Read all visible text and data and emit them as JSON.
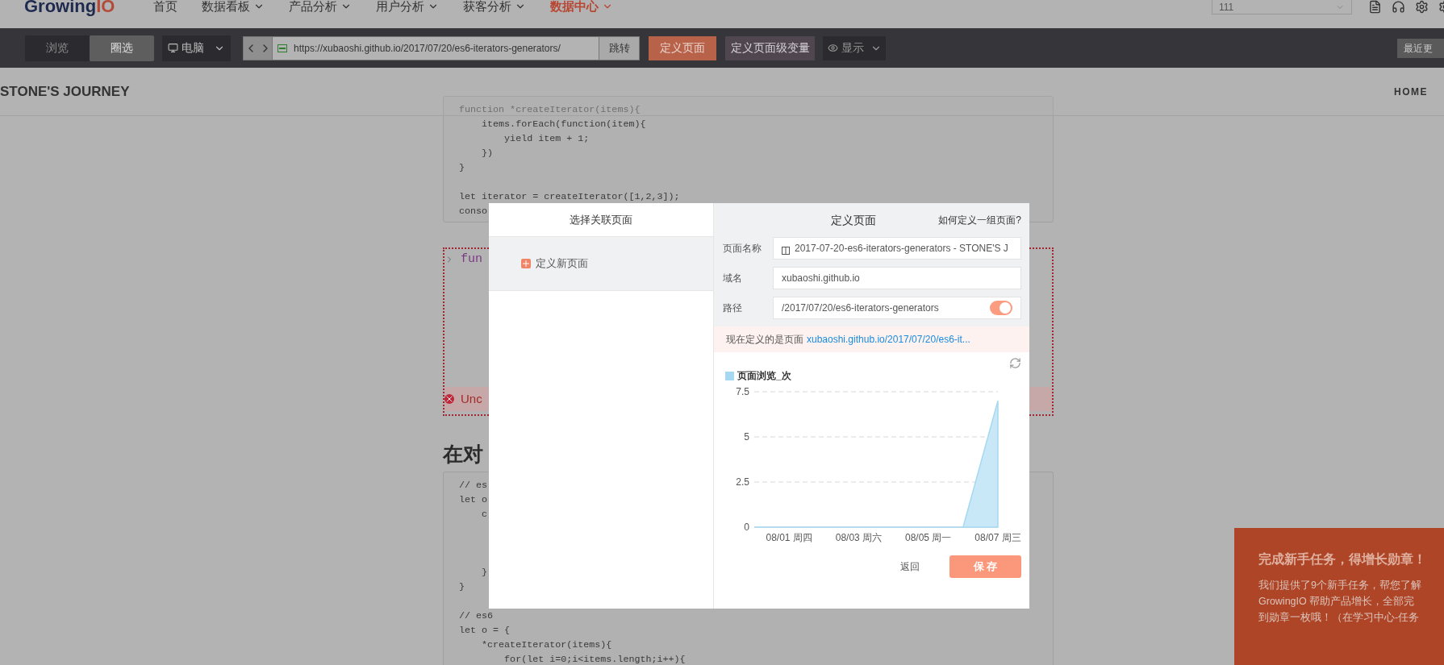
{
  "nav": {
    "logo": {
      "text": "Growing",
      "accent": "IO"
    },
    "items": [
      {
        "label": "首页",
        "dropdown": false,
        "selected": false
      },
      {
        "label": "数据看板",
        "dropdown": true,
        "selected": false
      },
      {
        "label": "产品分析",
        "dropdown": true,
        "selected": false
      },
      {
        "label": "用户分析",
        "dropdown": true,
        "selected": false
      },
      {
        "label": "获客分析",
        "dropdown": true,
        "selected": false
      },
      {
        "label": "数据中心",
        "dropdown": true,
        "selected": true
      }
    ],
    "project_select": {
      "value": "111"
    }
  },
  "toolbar": {
    "modes": [
      {
        "label": "浏览",
        "selected": false
      },
      {
        "label": "圈选",
        "selected": true
      }
    ],
    "device": {
      "label": "电脑"
    },
    "url": "https://xubaoshi.github.io/2017/07/20/es6-iterators-generators/",
    "go_button": "跳转",
    "define_page_button": "定义页面",
    "define_variable_button": "定义页面级变量",
    "display": {
      "label": "显示"
    },
    "recent_button": "最近更"
  },
  "site": {
    "title": "STONE'S JOURNEY",
    "nav_link": "HOME",
    "code_block_1": [
      {
        "kind": "faded",
        "text": "function *createIterator(items){"
      },
      {
        "kind": "code",
        "text": "    items.forEach(function(item){"
      },
      {
        "kind": "code",
        "text": "        yield item + 1;"
      },
      {
        "kind": "code",
        "text": "    })"
      },
      {
        "kind": "code",
        "text": "}"
      },
      {
        "kind": "blank"
      },
      {
        "kind": "code",
        "text": "let iterator = createIterator([1,2,3]);"
      },
      {
        "kind": "code",
        "text": "conso"
      }
    ],
    "console": {
      "input": "fun",
      "error": "Unc"
    },
    "heading": "在对",
    "code_block_2": [
      {
        "kind": "code",
        "text": "// es"
      },
      {
        "kind": "code",
        "text": "let o"
      },
      {
        "kind": "code",
        "text": "    c"
      },
      {
        "kind": "blank"
      },
      {
        "kind": "blank"
      },
      {
        "kind": "blank"
      },
      {
        "kind": "code",
        "text": "    }"
      },
      {
        "kind": "code",
        "text": "}"
      },
      {
        "kind": "blank"
      },
      {
        "kind": "code",
        "text": "// es6"
      },
      {
        "kind": "code",
        "text": "let o = {"
      },
      {
        "kind": "code",
        "text": "    *createIterator(items){"
      },
      {
        "kind": "code",
        "text": "        for(let i=0;i<items.length;i++){"
      }
    ]
  },
  "modal": {
    "left": {
      "title": "选择关联页面",
      "items": [
        {
          "label": "定义新页面",
          "selected": true
        }
      ]
    },
    "right": {
      "title": "定义页面",
      "help_link": "如何定义一组页面?",
      "fields": [
        {
          "label": "页面名称",
          "value": "2017-07-20-es6-iterators-generators - STONE'S J",
          "icon": true
        },
        {
          "label": "域名",
          "value": "xubaoshi.github.io",
          "icon": false
        },
        {
          "label": "路径",
          "value": "/2017/07/20/es6-iterators-generators",
          "icon": false,
          "toggle": {
            "on": true
          }
        }
      ],
      "notice": {
        "text": "现在定义的是页面",
        "link": "xubaoshi.github.io/2017/07/20/es6-it..."
      },
      "chart_data": {
        "type": "area",
        "categories": [
          null,
          "08/01 周四",
          null,
          "08/03 周六",
          null,
          "08/05 周一",
          null,
          "08/07 周三"
        ],
        "series": [
          {
            "name": "页面浏览_次",
            "color": "#a6d8f2",
            "values": [
              0,
              0,
              0,
              0,
              0,
              0,
              0,
              7
            ]
          }
        ],
        "ylim": [
          0,
          7.5
        ],
        "yticks": [
          0,
          2.5,
          5,
          7.5
        ]
      },
      "back_button": "返回",
      "save_button": "保 存"
    }
  },
  "notification": {
    "title": "完成新手任务，得增长勋章！",
    "lines": [
      "我们提供了9个新手任务，帮您了解",
      "GrowingIO 帮助产品增长，全部完",
      "到勋章一枚哦！（在学习中心-任务"
    ]
  }
}
